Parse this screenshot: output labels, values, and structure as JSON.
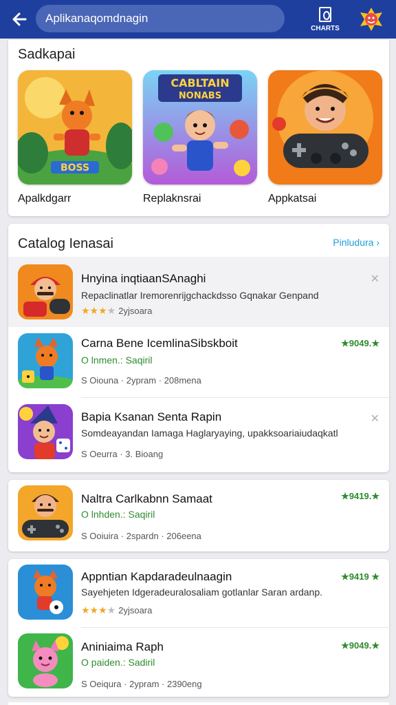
{
  "header": {
    "search_text": "Aplikanaqomdnagin",
    "charts_label": "CHARTS",
    "colors": {
      "bar": "#1f3f9e",
      "search": "#4a66b6"
    }
  },
  "featured": {
    "title": "Sadkapai",
    "items": [
      {
        "caption": "Apalkdgarr",
        "art_text": "BOSS",
        "icon": "fox-warrior-game-art"
      },
      {
        "caption": "Replaknsrai",
        "art_text": "CABLTAIN\nNONABS",
        "icon": "hero-boy-game-art"
      },
      {
        "caption": "Appkatsai",
        "art_text": "",
        "icon": "gamer-controller-art"
      }
    ]
  },
  "catalog": {
    "title": "Catalog Ienasai",
    "see_all": "Pinludura",
    "apps": [
      {
        "title": "Hnyina inqtiaanSAnaghi",
        "subtitle": "Repaclinatlar Iremorenrijgchackdsso Gqnakar Genpand",
        "stars": 3,
        "count": "2yjsoara",
        "close": true,
        "icon": "mario-controller-icon"
      },
      {
        "title": "Carna Bene IcemlinaSibskboit",
        "subtitle": "O lnmen.: Saqiril",
        "meta": "S Oiouna · 2ypram · 208mena",
        "rating": "★9049.★",
        "icon": "fox-dice-icon"
      },
      {
        "title": "Bapia Ksanan Senta Rapin",
        "subtitle": "Somdeayandan Iamaga Haglaryaying, upakksoariaiudaqkatl",
        "meta": "S Oeurra · 3. Bioang",
        "close": true,
        "icon": "wizard-dice-icon"
      }
    ]
  },
  "single": {
    "title": "Naltra Carlkabnn Samaat",
    "subtitle": "O lnhden.: Saqiril",
    "meta": "S Ooiuira · 2spardn · 206eena",
    "rating": "★9419.★",
    "icon": "gamer-controller-icon"
  },
  "double": [
    {
      "title": "Appntian Kapdaradeulnaagin",
      "subtitle": "Sayehjeten Idgeradeuralosaliam gotlanlar Saran ardanp.",
      "stars": 3,
      "count": "2yjsoara",
      "rating": "★9419 ★",
      "icon": "fox-ball-icon"
    },
    {
      "title": "Aniniaima Raph",
      "subtitle": "O paiden.: Sadiril",
      "meta": "S Oeiqura · 2ypram · 2390eng",
      "rating": "★9049.★",
      "icon": "pink-cat-icon"
    }
  ]
}
